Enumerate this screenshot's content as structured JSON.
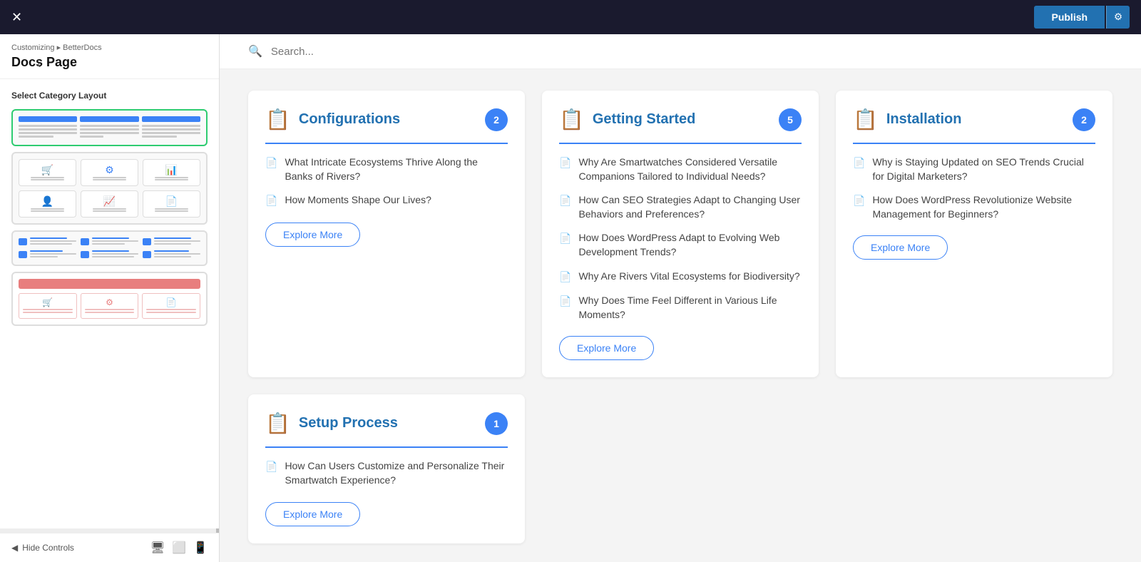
{
  "topbar": {
    "close_label": "✕",
    "publish_label": "Publish",
    "gear_label": "⚙"
  },
  "sidebar": {
    "breadcrumb": "Customizing ▸ BetterDocs",
    "page_title": "Docs Page",
    "back_icon": "‹",
    "section_label": "Select Category Layout",
    "hide_controls_label": "Hide Controls"
  },
  "search": {
    "placeholder": "Search..."
  },
  "categories": [
    {
      "id": "configurations",
      "title": "Configurations",
      "count": "2",
      "items": [
        "What Intricate Ecosystems Thrive Along the Banks of Rivers?",
        "How Moments Shape Our Lives?"
      ],
      "explore_label": "Explore More"
    },
    {
      "id": "getting-started",
      "title": "Getting Started",
      "count": "5",
      "items": [
        "Why Are Smartwatches Considered Versatile Companions Tailored to Individual Needs?",
        "How Can SEO Strategies Adapt to Changing User Behaviors and Preferences?",
        "How Does WordPress Adapt to Evolving Web Development Trends?",
        "Why Are Rivers Vital Ecosystems for Biodiversity?",
        "Why Does Time Feel Different in Various Life Moments?"
      ],
      "explore_label": "Explore More"
    },
    {
      "id": "installation",
      "title": "Installation",
      "count": "2",
      "items": [
        "Why is Staying Updated on SEO Trends Crucial for Digital Marketers?",
        "How Does WordPress Revolutionize Website Management for Beginners?"
      ],
      "explore_label": "Explore More"
    },
    {
      "id": "setup-process",
      "title": "Setup Process",
      "count": "1",
      "items": [
        "How Can Users Customize and Personalize Their Smartwatch Experience?"
      ],
      "explore_label": "Explore More"
    }
  ]
}
